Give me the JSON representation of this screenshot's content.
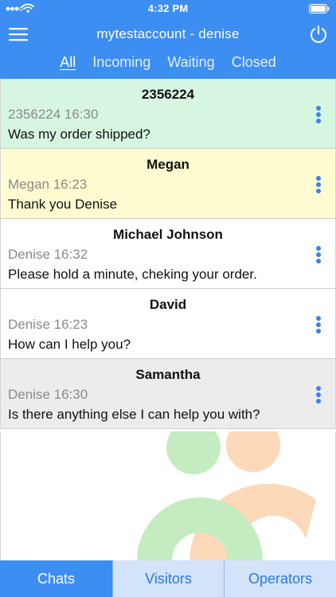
{
  "status_bar": {
    "time": "4:32 PM"
  },
  "header": {
    "title": "mytestaccount - denise",
    "menu_icon": "hamburger-menu-icon",
    "power_icon": "power-icon",
    "background": "#3d8ef2"
  },
  "tabs": [
    {
      "label": "All",
      "active": true
    },
    {
      "label": "Incoming",
      "active": false
    },
    {
      "label": "Waiting",
      "active": false
    },
    {
      "label": "Closed",
      "active": false
    }
  ],
  "chats": [
    {
      "name": "2356224",
      "meta": "2356224 16:30",
      "message": "Was my order shipped?",
      "color": "#d7f6e1"
    },
    {
      "name": "Megan",
      "meta": "Megan 16:23",
      "message": "Thank you Denise",
      "color": "#fffcd2"
    },
    {
      "name": "Michael Johnson",
      "meta": "Denise 16:32",
      "message": "Please hold a minute, cheking your order.",
      "color": "#ffffff"
    },
    {
      "name": "David",
      "meta": "Denise 16:23",
      "message": "How can I help you?",
      "color": "#ffffff"
    },
    {
      "name": "Samantha",
      "meta": "Denise 16:30",
      "message": "Is there anything else I can help you with?",
      "color": "#ececec"
    }
  ],
  "bottom_nav": {
    "chats": "Chats",
    "visitors": "Visitors",
    "operators": "Operators",
    "active": "Chats"
  },
  "colors": {
    "accent": "#3d8ef2",
    "more_dots": "#3d82e6",
    "logo_green": "#c4ecc0",
    "logo_orange": "#fbd9b9"
  }
}
